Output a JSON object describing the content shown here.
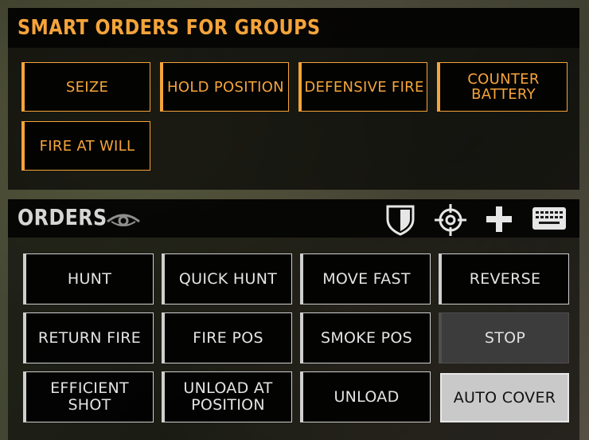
{
  "smart_orders": {
    "title": "SMART ORDERS FOR GROUPS",
    "buttons": [
      "SEIZE",
      "HOLD POSITION",
      "DEFENSIVE FIRE",
      "COUNTER BATTERY",
      "FIRE AT WILL"
    ]
  },
  "orders": {
    "title": "ORDERS",
    "header_icons": [
      "eye-icon",
      "shield-icon",
      "crosshair-icon",
      "plus-icon",
      "keyboard-icon"
    ],
    "buttons": [
      "HUNT",
      "QUICK HUNT",
      "MOVE FAST",
      "REVERSE",
      "RETURN FIRE",
      "FIRE POS",
      "SMOKE POS",
      "STOP",
      "EFFICIENT SHOT",
      "UNLOAD AT POSITION",
      "UNLOAD",
      "AUTO COVER"
    ]
  },
  "colors": {
    "accent_orange": "#f5a43a",
    "button_border": "#cfcfcf",
    "stop_bg": "#3c3c3c",
    "auto_cover_bg": "#c9c9c9"
  }
}
